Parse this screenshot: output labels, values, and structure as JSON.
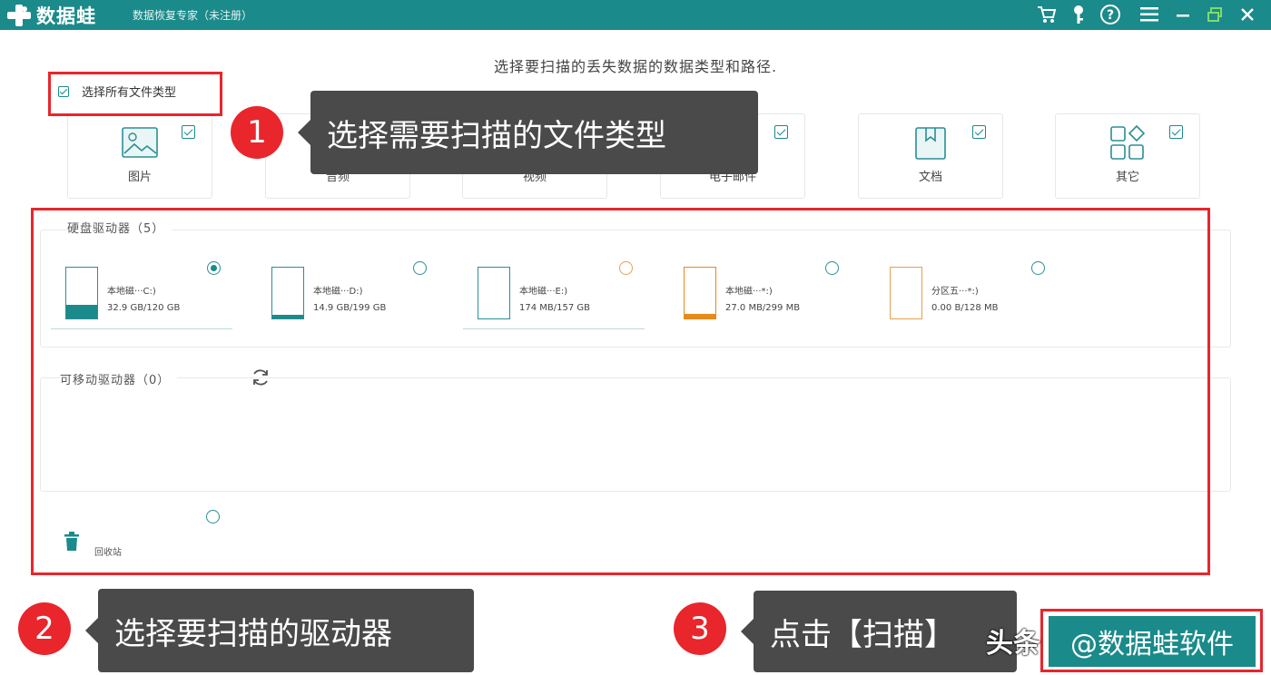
{
  "titlebar": {
    "app_name": "数据蛙",
    "subtitle": "数据恢复专家（未注册）",
    "icons": [
      "cart-icon",
      "key-icon",
      "help-icon",
      "menu-icon",
      "minimize-icon",
      "restore-icon",
      "close-icon"
    ]
  },
  "header": {
    "instruction": "选择要扫描的丢失数据的数据类型和路径."
  },
  "select_all": {
    "label": "选择所有文件类型",
    "checked": true
  },
  "file_types": [
    {
      "label": "图片",
      "icon": "image-icon",
      "checked": true
    },
    {
      "label": "音频",
      "icon": "audio-icon",
      "checked": true
    },
    {
      "label": "视频",
      "icon": "video-icon",
      "checked": true
    },
    {
      "label": "电子邮件",
      "icon": "email-icon",
      "checked": true
    },
    {
      "label": "文档",
      "icon": "document-icon",
      "checked": true
    },
    {
      "label": "其它",
      "icon": "others-icon",
      "checked": true
    }
  ],
  "hard_drives": {
    "title": "硬盘驱动器（5）",
    "items": [
      {
        "name": "本地磁···C:)",
        "size": "32.9 GB/120 GB",
        "selected": true,
        "used_fraction": 0.27,
        "color": "#1b8a8a"
      },
      {
        "name": "本地磁···D:)",
        "size": "14.9 GB/199 GB",
        "selected": false,
        "used_fraction": 0.07,
        "color": "#1b8a8a"
      },
      {
        "name": "本地磁···E:)",
        "size": "174 MB/157 GB",
        "selected": false,
        "used_fraction": 0.0,
        "color": "#1b8a8a"
      },
      {
        "name": "本地磁···*:)",
        "size": "27.0 MB/299 MB",
        "selected": false,
        "used_fraction": 0.09,
        "color": "#e8891a"
      },
      {
        "name": "分区五···*:)",
        "size": "0.00 B/128 MB",
        "selected": false,
        "used_fraction": 0.0,
        "color": "#e8a050"
      }
    ]
  },
  "removable_drives": {
    "title": "可移动驱动器（0）",
    "refresh_icon": "refresh-icon"
  },
  "recycle_bin": {
    "label": "回收站",
    "icon": "trash-icon",
    "selected": false
  },
  "annotations": [
    {
      "number": "1",
      "text": "选择需要扫描的文件类型"
    },
    {
      "number": "2",
      "text": "选择要扫描的驱动器"
    },
    {
      "number": "3",
      "text": "点击【扫描】"
    }
  ],
  "scan_button": {
    "label": "@数据蛙软件"
  },
  "watermark": "头条",
  "colors": {
    "brand": "#1b8a8a",
    "annotation_red": "#e8262c",
    "tooltip_gray": "#4a4a4a"
  }
}
